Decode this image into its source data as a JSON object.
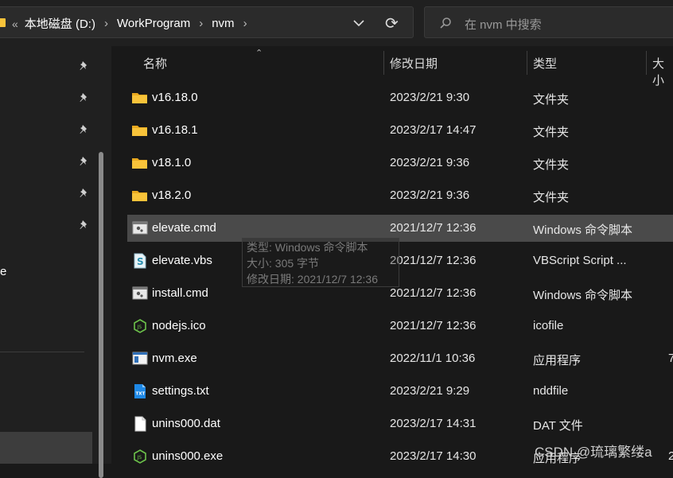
{
  "address_bar": {
    "overflow_symbol": "«",
    "breadcrumbs": [
      "本地磁盘 (D:)",
      "WorkProgram",
      "nvm"
    ],
    "separator": "›"
  },
  "search": {
    "placeholder": "在 nvm 中搜索"
  },
  "nav_pane": {
    "partial_label": "e",
    "pinned_count": 6
  },
  "columns": {
    "name": "名称",
    "modified": "修改日期",
    "type": "类型",
    "size": "大小"
  },
  "files": [
    {
      "name": "v16.18.0",
      "modified": "2023/2/21 9:30",
      "type": "文件夹",
      "size": "",
      "icon": "folder-icon"
    },
    {
      "name": "v16.18.1",
      "modified": "2023/2/17 14:47",
      "type": "文件夹",
      "size": "",
      "icon": "folder-icon"
    },
    {
      "name": "v18.1.0",
      "modified": "2023/2/21 9:36",
      "type": "文件夹",
      "size": "",
      "icon": "folder-icon"
    },
    {
      "name": "v18.2.0",
      "modified": "2023/2/21 9:36",
      "type": "文件夹",
      "size": "",
      "icon": "folder-icon"
    },
    {
      "name": "elevate.cmd",
      "modified": "2021/12/7 12:36",
      "type": "Windows 命令脚本",
      "size": "",
      "icon": "cmd-script-icon",
      "selected": true
    },
    {
      "name": "elevate.vbs",
      "modified": "2021/12/7 12:36",
      "type": "VBScript Script ...",
      "size": "",
      "icon": "vbscript-icon"
    },
    {
      "name": "install.cmd",
      "modified": "2021/12/7 12:36",
      "type": "Windows 命令脚本",
      "size": "",
      "icon": "cmd-script-icon"
    },
    {
      "name": "nodejs.ico",
      "modified": "2021/12/7 12:36",
      "type": "icofile",
      "size": "",
      "icon": "nodejs-icon"
    },
    {
      "name": "nvm.exe",
      "modified": "2022/11/1 10:36",
      "type": "应用程序",
      "size": "7",
      "icon": "exe-window-icon"
    },
    {
      "name": "settings.txt",
      "modified": "2023/2/21 9:29",
      "type": "nddfile",
      "size": "",
      "icon": "txt-file-icon"
    },
    {
      "name": "unins000.dat",
      "modified": "2023/2/17 14:31",
      "type": "DAT 文件",
      "size": "",
      "icon": "blank-file-icon"
    },
    {
      "name": "unins000.exe",
      "modified": "2023/2/17 14:30",
      "type": "应用程序",
      "size": "2",
      "icon": "nodejs-icon"
    }
  ],
  "tooltip": {
    "type_line": "类型: Windows 命令脚本",
    "size_line": "大小: 305 字节",
    "date_line": "修改日期: 2021/12/7 12:36"
  },
  "watermark": "CSDN @琉璃繁缕a",
  "colors": {
    "background": "#191919",
    "selected_row": "#4a4a4a",
    "folder": "#f8c33a",
    "nodejs": "#6cc24a",
    "txt_blue": "#1e88e5"
  }
}
